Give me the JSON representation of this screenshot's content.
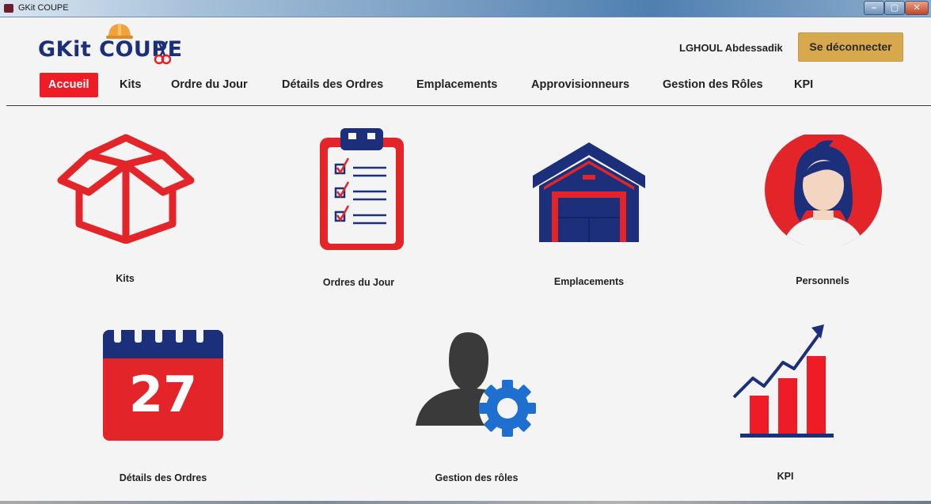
{
  "window": {
    "title": "GKit COUPE",
    "controls": [
      "–",
      "▢",
      "✕"
    ]
  },
  "header": {
    "logo": "GKit COUPE",
    "user_name": "LGHOUL Abdessadik",
    "logout_label": "Se déconnecter"
  },
  "nav": {
    "items": [
      {
        "label": "Accueil",
        "active": true
      },
      {
        "label": "Kits"
      },
      {
        "label": "Ordre du Jour"
      },
      {
        "label": "Détails des Ordres"
      },
      {
        "label": "Emplacements"
      },
      {
        "label": "Approvisionneurs"
      },
      {
        "label": "Gestion des Rôles"
      },
      {
        "label": "KPI"
      }
    ]
  },
  "tiles": [
    {
      "label": "Kits",
      "icon": "box-icon"
    },
    {
      "label": "Ordres du Jour",
      "icon": "clipboard-checklist-icon"
    },
    {
      "label": "Emplacements",
      "icon": "warehouse-icon"
    },
    {
      "label": "Personnels",
      "icon": "user-avatar-icon"
    },
    {
      "label": "Détails des Ordres",
      "icon": "calendar-icon",
      "calendar_day": "27"
    },
    {
      "label": "Gestion des rôles",
      "icon": "user-gear-icon"
    },
    {
      "label": "KPI",
      "icon": "bar-chart-growth-icon"
    }
  ],
  "colors": {
    "accent_red": "#ee1c25",
    "navy": "#1c2f7a",
    "logout_gold": "#d7a84c",
    "gear_blue": "#1f6fd1",
    "background": "#f4f4f4"
  }
}
